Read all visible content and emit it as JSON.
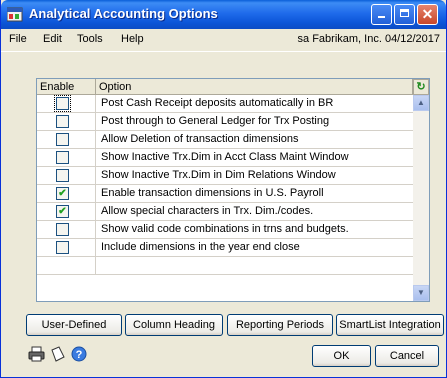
{
  "window": {
    "title": "Analytical Accounting Options"
  },
  "menu": {
    "items": [
      "File",
      "Edit",
      "Tools",
      "Help"
    ],
    "user_info": "sa  Fabrikam, Inc.  04/12/2017"
  },
  "list": {
    "headers": {
      "enable": "Enable",
      "option": "Option"
    },
    "rows": [
      {
        "option": "Post Cash Receipt deposits automatically in BR",
        "checked": false
      },
      {
        "option": "Post through to General Ledger for Trx Posting",
        "checked": false
      },
      {
        "option": "Allow Deletion of transaction dimensions",
        "checked": false
      },
      {
        "option": "Show Inactive Trx.Dim in Acct Class Maint Window",
        "checked": false
      },
      {
        "option": "Show Inactive Trx.Dim in Dim Relations Window",
        "checked": false
      },
      {
        "option": "Enable transaction dimensions in U.S. Payroll",
        "checked": true
      },
      {
        "option": "Allow special characters in Trx. Dim./codes.",
        "checked": true
      },
      {
        "option": "Show valid code combinations in trns and budgets.",
        "checked": false
      },
      {
        "option": "Include dimensions in the year end close",
        "checked": false
      }
    ]
  },
  "buttons": {
    "user_defined": "User-Defined",
    "column_heading": "Column Heading",
    "reporting_periods": "Reporting Periods",
    "smartlist_integration": "SmartList Integration",
    "ok": "OK",
    "cancel": "Cancel"
  }
}
